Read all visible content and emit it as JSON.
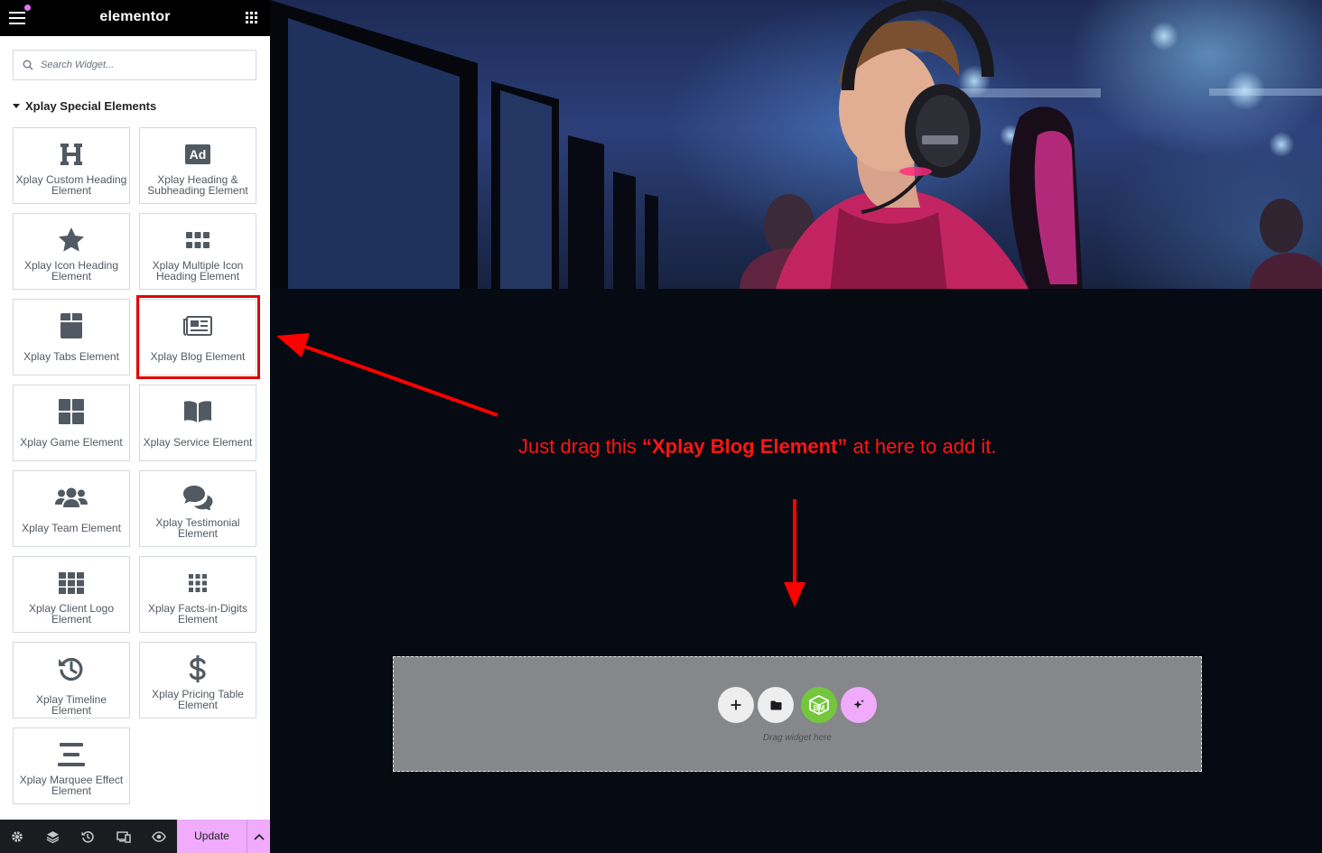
{
  "topbar": {
    "logo": "elementor",
    "accent": "#e073f3"
  },
  "search": {
    "placeholder": "Search Widget..."
  },
  "category": {
    "title": "Xplay Special Elements"
  },
  "widgets": [
    {
      "label": "Xplay Custom Heading Element",
      "icon": "heading-icon"
    },
    {
      "label": "Xplay Heading & Subheading Element",
      "icon": "ad-icon"
    },
    {
      "label": "Xplay Icon Heading Element",
      "icon": "star-icon"
    },
    {
      "label": "Xplay Multiple Icon Heading Element",
      "icon": "multi-icon"
    },
    {
      "label": "Xplay Tabs Element",
      "icon": "box-icon"
    },
    {
      "label": "Xplay Blog Element",
      "icon": "newspaper-icon"
    },
    {
      "label": "Xplay Game Element",
      "icon": "grid-icon"
    },
    {
      "label": "Xplay Service Element",
      "icon": "book-icon"
    },
    {
      "label": "Xplay Team Element",
      "icon": "users-icon"
    },
    {
      "label": "Xplay Testimonial Element",
      "icon": "comments-icon"
    },
    {
      "label": "Xplay Client Logo Element",
      "icon": "logo-grid-icon"
    },
    {
      "label": "Xplay Facts-in-Digits Element",
      "icon": "dots-grid-icon"
    },
    {
      "label": "Xplay Timeline Element",
      "icon": "history-icon"
    },
    {
      "label": "Xplay Pricing Table Element",
      "icon": "dollar-icon"
    },
    {
      "label": "Xplay Marquee Effect Element",
      "icon": "align-icon"
    }
  ],
  "footer": {
    "update_label": "Update",
    "update_color": "#f0abfc"
  },
  "canvas": {
    "instruction_pre": "Just drag this ",
    "instruction_bold": "“Xplay Blog Element”",
    "instruction_post": " at here to add it.",
    "instruction_color": "#ff1515",
    "dropzone_hint": "Drag widget here"
  }
}
